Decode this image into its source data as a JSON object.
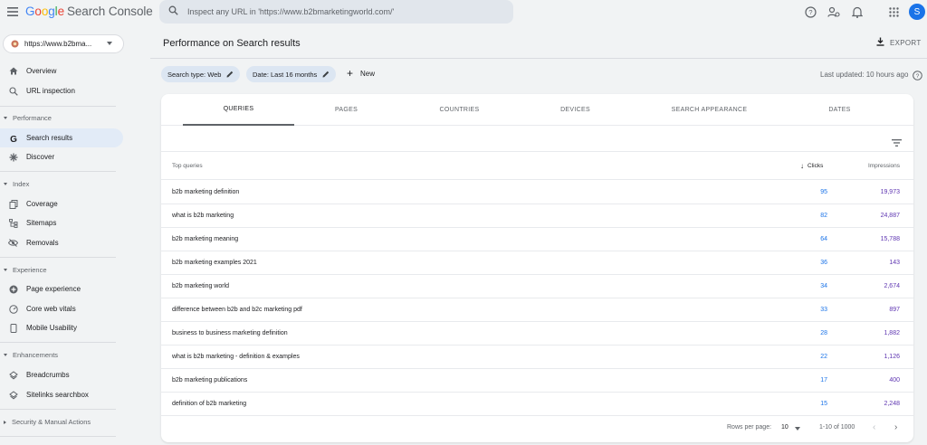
{
  "app": {
    "logo_letters": [
      "G",
      "o",
      "o",
      "g",
      "l",
      "e"
    ],
    "logo_rest": "Search Console"
  },
  "search": {
    "placeholder": "Inspect any URL in 'https://www.b2bmarketingworld.com/'"
  },
  "user": {
    "avatar_letter": "S"
  },
  "property": {
    "label": "https://www.b2bma..."
  },
  "sidebar": {
    "overview": "Overview",
    "url_inspection": "URL inspection",
    "performance_header": "Performance",
    "search_results": "Search results",
    "discover": "Discover",
    "index_header": "Index",
    "coverage": "Coverage",
    "sitemaps": "Sitemaps",
    "removals": "Removals",
    "experience_header": "Experience",
    "page_experience": "Page experience",
    "core_web_vitals": "Core web vitals",
    "mobile_usability": "Mobile Usability",
    "enhancements_header": "Enhancements",
    "breadcrumbs": "Breadcrumbs",
    "sitelinks_searchbox": "Sitelinks searchbox",
    "security_header": "Security & Manual Actions"
  },
  "header": {
    "title": "Performance on Search results",
    "export_label": "EXPORT"
  },
  "filters": {
    "search_type": "Search type: Web",
    "date": "Date: Last 16 months",
    "new_label": "New",
    "last_updated": "Last updated: 10 hours ago"
  },
  "tabs": [
    "QUERIES",
    "PAGES",
    "COUNTRIES",
    "DEVICES",
    "SEARCH APPEARANCE",
    "DATES"
  ],
  "table": {
    "col_query": "Top queries",
    "col_clicks": "Clicks",
    "col_impressions": "Impressions",
    "rows": [
      {
        "query": "b2b marketing definition",
        "clicks": "95",
        "impressions": "19,973"
      },
      {
        "query": "what is b2b marketing",
        "clicks": "82",
        "impressions": "24,887"
      },
      {
        "query": "b2b marketing meaning",
        "clicks": "64",
        "impressions": "15,788"
      },
      {
        "query": "b2b marketing examples 2021",
        "clicks": "36",
        "impressions": "143"
      },
      {
        "query": "b2b marketing world",
        "clicks": "34",
        "impressions": "2,674"
      },
      {
        "query": "difference between b2b and b2c marketing pdf",
        "clicks": "33",
        "impressions": "897"
      },
      {
        "query": "business to business marketing definition",
        "clicks": "28",
        "impressions": "1,882"
      },
      {
        "query": "what is b2b marketing - definition & examples",
        "clicks": "22",
        "impressions": "1,126"
      },
      {
        "query": "b2b marketing publications",
        "clicks": "17",
        "impressions": "400"
      },
      {
        "query": "definition of b2b marketing",
        "clicks": "15",
        "impressions": "2,248"
      }
    ]
  },
  "pager": {
    "rows_per_page_label": "Rows per page:",
    "rows_per_page_value": "10",
    "range": "1-10 of 1000"
  },
  "colors": {
    "accent": "#1a73e8",
    "impressions": "#5e35b1",
    "active_nav": "#e2ebf7"
  }
}
